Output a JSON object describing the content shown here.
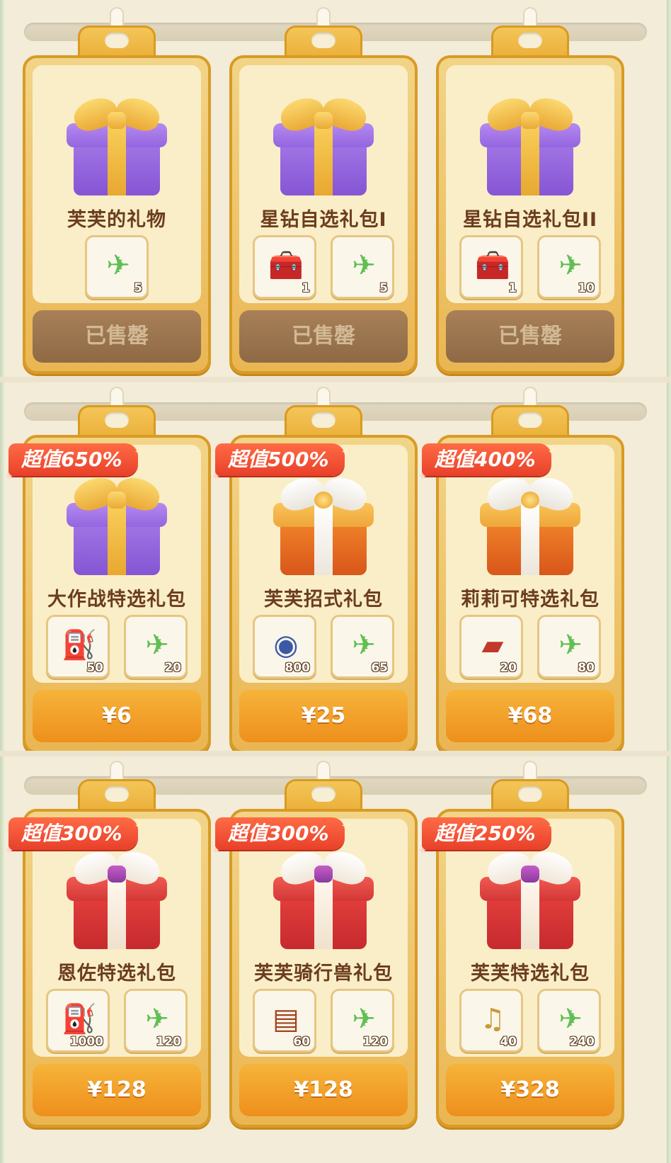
{
  "sections": [
    {
      "cards": [
        {
          "name": "芙芙的礼物",
          "gift": "purple",
          "badge": "",
          "button": "已售罄",
          "sold": true,
          "items": [
            {
              "icon": "paper-plane-icon",
              "glyph": "✈",
              "color": "#5fbf54",
              "qty": "5"
            }
          ]
        },
        {
          "name": "星钻自选礼包I",
          "gift": "purple",
          "badge": "",
          "button": "已售罄",
          "sold": true,
          "items": [
            {
              "icon": "treasure-chest-icon",
              "glyph": "🧰",
              "color": "#b8542a",
              "qty": "1"
            },
            {
              "icon": "paper-plane-icon",
              "glyph": "✈",
              "color": "#5fbf54",
              "qty": "5"
            }
          ]
        },
        {
          "name": "星钻自选礼包II",
          "gift": "purple",
          "badge": "",
          "button": "已售罄",
          "sold": true,
          "items": [
            {
              "icon": "jeweled-chest-icon",
              "glyph": "🧰",
              "color": "#c0392b",
              "qty": "1"
            },
            {
              "icon": "paper-plane-icon",
              "glyph": "✈",
              "color": "#5fbf54",
              "qty": "10"
            }
          ]
        }
      ]
    },
    {
      "cards": [
        {
          "name": "大作战特选礼包",
          "gift": "purple",
          "badge": "超值650%",
          "button": "¥6",
          "sold": false,
          "items": [
            {
              "icon": "energy-canister-icon",
              "glyph": "⛽",
              "color": "#4aa8e8",
              "qty": "50"
            },
            {
              "icon": "paper-plane-icon",
              "glyph": "✈",
              "color": "#5fbf54",
              "qty": "20"
            }
          ]
        },
        {
          "name": "芙芙招式礼包",
          "gift": "orange",
          "badge": "超值500%",
          "button": "¥25",
          "sold": false,
          "items": [
            {
              "icon": "crystal-orb-icon",
              "glyph": "◉",
              "color": "#3a5aa8",
              "qty": "800"
            },
            {
              "icon": "paper-plane-icon",
              "glyph": "✈",
              "color": "#5fbf54",
              "qty": "65"
            }
          ]
        },
        {
          "name": "莉莉可特选礼包",
          "gift": "orange",
          "badge": "超值400%",
          "button": "¥68",
          "sold": false,
          "items": [
            {
              "icon": "card-icon",
              "glyph": "▰",
              "color": "#c0392b",
              "qty": "20"
            },
            {
              "icon": "paper-plane-icon",
              "glyph": "✈",
              "color": "#5fbf54",
              "qty": "80"
            }
          ]
        }
      ]
    },
    {
      "cards": [
        {
          "name": "恩佐特选礼包",
          "gift": "red",
          "badge": "超值300%",
          "button": "¥128",
          "sold": false,
          "items": [
            {
              "icon": "energy-canister-icon",
              "glyph": "⛽",
              "color": "#4aa8e8",
              "qty": "1000"
            },
            {
              "icon": "paper-plane-icon",
              "glyph": "✈",
              "color": "#5fbf54",
              "qty": "120"
            }
          ]
        },
        {
          "name": "芙芙骑行兽礼包",
          "gift": "red",
          "badge": "超值300%",
          "button": "¥128",
          "sold": false,
          "items": [
            {
              "icon": "ticket-stack-icon",
              "glyph": "▤",
              "color": "#a0441e",
              "qty": "60"
            },
            {
              "icon": "paper-plane-icon",
              "glyph": "✈",
              "color": "#5fbf54",
              "qty": "120"
            }
          ]
        },
        {
          "name": "芙芙特选礼包",
          "gift": "red",
          "badge": "超值250%",
          "button": "¥328",
          "sold": false,
          "items": [
            {
              "icon": "lyre-icon",
              "glyph": "♫",
              "color": "#c99a3a",
              "qty": "40"
            },
            {
              "icon": "paper-plane-icon",
              "glyph": "✈",
              "color": "#5fbf54",
              "qty": "240"
            }
          ]
        }
      ]
    }
  ]
}
